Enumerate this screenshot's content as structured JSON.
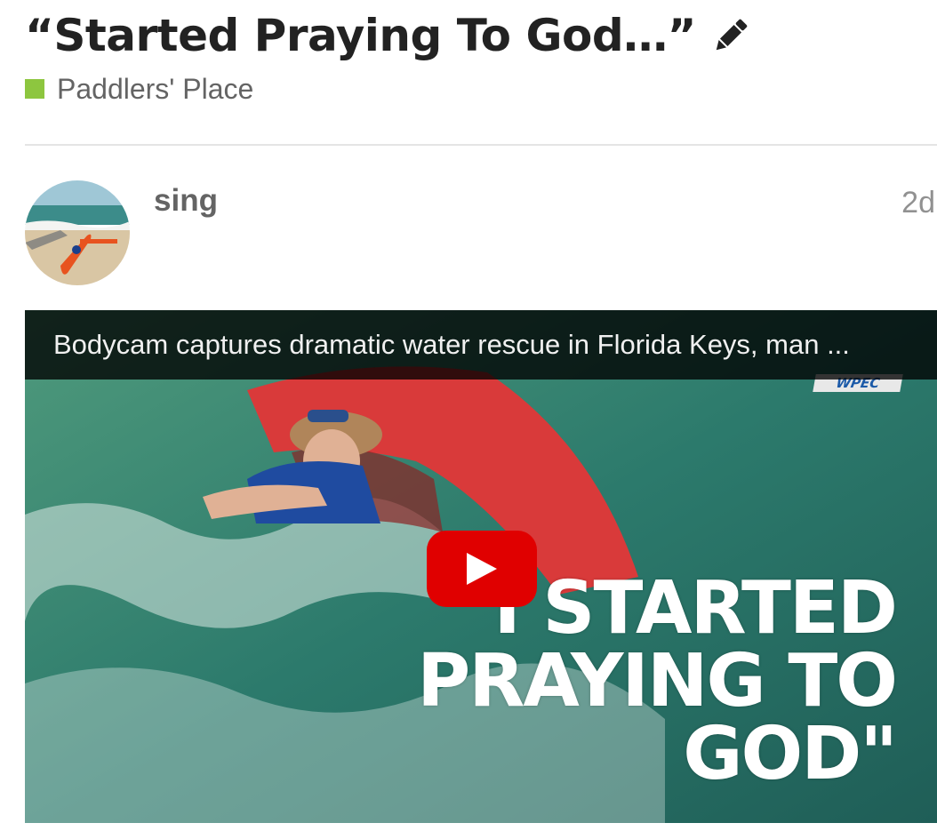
{
  "topic": {
    "title": "“Started Praying To God…”",
    "edit_icon": "pencil-icon"
  },
  "category": {
    "name": "Paddlers' Place",
    "color": "#8dc63f"
  },
  "post": {
    "username": "sing",
    "age": "2d",
    "avatar": "kayak-on-beach-avatar"
  },
  "video": {
    "title": "Bodycam captures dramatic water rescue in Florida Keys, man ...",
    "channel_badge": "WPEC",
    "overlay_lines": [
      "\"I STARTED",
      "PRAYING TO",
      "GOD\""
    ],
    "play_icon": "play-icon",
    "play_button_color": "#e00000"
  }
}
